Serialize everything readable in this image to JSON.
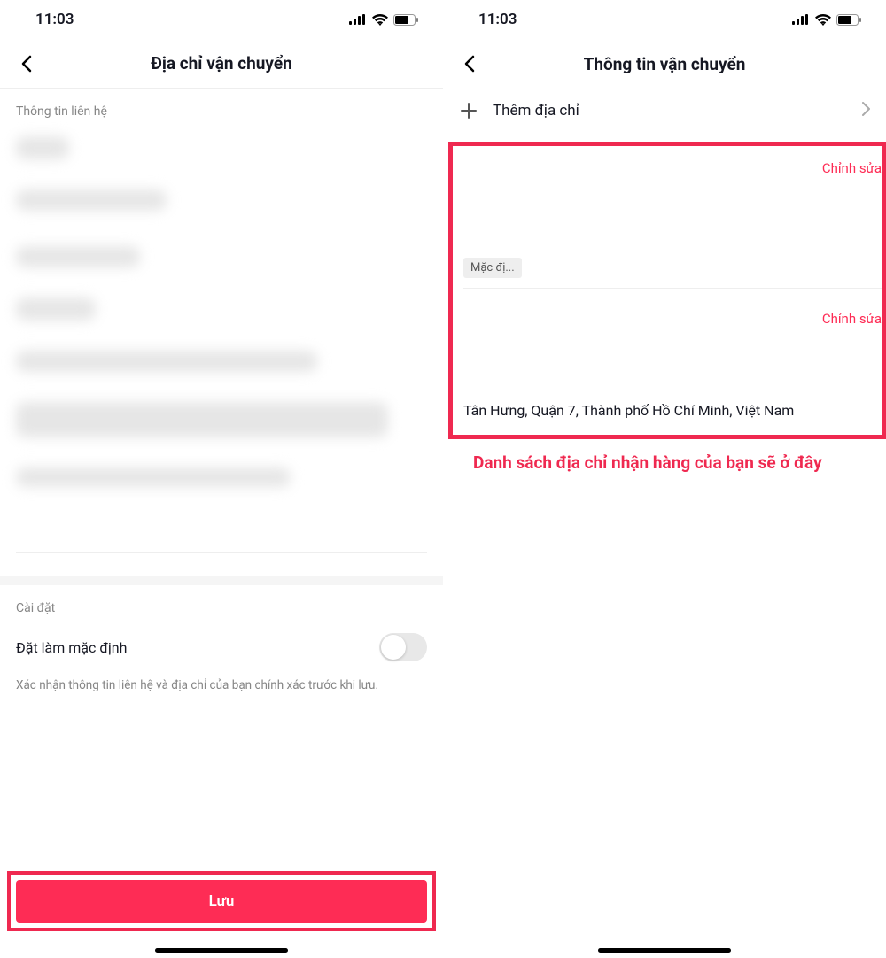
{
  "status": {
    "time": "11:03"
  },
  "left": {
    "title": "Địa chỉ vận chuyển",
    "contact_section": "Thông tin liên hệ",
    "settings_section": "Cài đặt",
    "default_toggle_label": "Đặt làm mặc định",
    "hint": "Xác nhận thông tin liên hệ và địa chỉ của bạn chính xác trước khi lưu.",
    "save_label": "Lưu"
  },
  "right": {
    "title": "Thông tin vận chuyển",
    "add_label": "Thêm địa chỉ",
    "edit_label": "Chỉnh sửa",
    "default_badge": "Mặc đị...",
    "address_line": "Tân Hưng, Quận 7, Thành phố Hồ Chí Minh, Việt Nam",
    "annotation": "Danh sách địa chỉ nhận hàng của bạn sẽ ở đây"
  }
}
